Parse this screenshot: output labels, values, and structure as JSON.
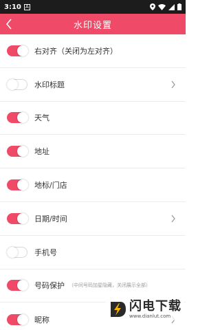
{
  "status_bar": {
    "time": "3:10",
    "notification_icon": "A"
  },
  "nav": {
    "title": "水印设置",
    "back_icon": "chevron-left-icon"
  },
  "settings": [
    {
      "label": "右对齐（关闭为左对齐）",
      "enabled": true,
      "has_arrow": false,
      "note": ""
    },
    {
      "label": "水印标题",
      "enabled": false,
      "has_arrow": true,
      "note": ""
    },
    {
      "label": "天气",
      "enabled": true,
      "has_arrow": false,
      "note": ""
    },
    {
      "label": "地址",
      "enabled": true,
      "has_arrow": false,
      "note": ""
    },
    {
      "label": "地标/门店",
      "enabled": true,
      "has_arrow": false,
      "note": ""
    },
    {
      "label": "日期/时间",
      "enabled": true,
      "has_arrow": true,
      "note": ""
    },
    {
      "label": "手机号",
      "enabled": false,
      "has_arrow": false,
      "note": ""
    },
    {
      "label": "号码保护",
      "enabled": true,
      "has_arrow": false,
      "note": "（中间号码加星隐藏，关闭展示全部）"
    },
    {
      "label": "昵称",
      "enabled": true,
      "has_arrow": true,
      "note": ""
    }
  ],
  "colors": {
    "accent": "#ef4b68",
    "status_bar": "#1c1c1c"
  },
  "watermark": {
    "name": "闪电下载",
    "url": "www.dianlut.com"
  }
}
